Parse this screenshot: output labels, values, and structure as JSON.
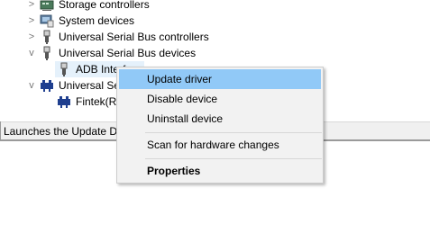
{
  "tree": {
    "items": [
      {
        "label": "Storage controllers",
        "icon": "storage-controller-icon",
        "chevron": ">"
      },
      {
        "label": "System devices",
        "icon": "system-devices-icon",
        "chevron": ">"
      },
      {
        "label": "Universal Serial Bus controllers",
        "icon": "usb-icon",
        "chevron": ">"
      },
      {
        "label": "Universal Serial Bus devices",
        "icon": "usb-icon",
        "chevron": "v"
      },
      {
        "label": "ADB Interface",
        "icon": "usb-icon",
        "chevron": ""
      },
      {
        "label": "Universal Serial Bus",
        "icon": "usb-hub-icon",
        "chevron": "v"
      },
      {
        "label": "Fintek(R)",
        "icon": "usb-hub-icon",
        "chevron": ""
      }
    ]
  },
  "status_bar": {
    "text": "Launches the Update Driver Wizard for the selected device."
  },
  "context_menu": {
    "items": [
      {
        "label": "Update driver",
        "highlighted": true
      },
      {
        "label": "Disable device"
      },
      {
        "label": "Uninstall device"
      },
      {
        "label": "Scan for hardware changes"
      },
      {
        "label": "Properties",
        "bold": true
      }
    ]
  },
  "colors": {
    "menu_bg": "#f2f2f2",
    "menu_highlight": "#91c9f7",
    "selection_bg": "#e5f1fb",
    "status_bar_bg": "#f0f0f0"
  }
}
